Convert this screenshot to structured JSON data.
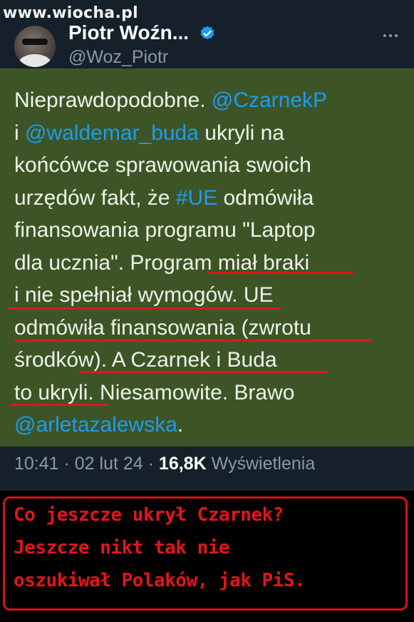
{
  "watermark": "www.wiocha.pl",
  "author": {
    "display_name": "Piotr Woźn...",
    "handle": "@Woz_Piotr"
  },
  "icons": {
    "verified": "verified-badge-icon",
    "more": "more-options-icon"
  },
  "colors": {
    "mention": "#1d9bf0",
    "tweet_highlight": "#3d5526",
    "underline": "#e0151a",
    "caption": "#e4141c"
  },
  "tweet": {
    "lines": [
      [
        {
          "text": "Nieprawdopodobne. "
        },
        {
          "text": "@CzarnekP",
          "mention": true
        }
      ],
      [
        {
          "text": "i "
        },
        {
          "text": "@waldemar_buda",
          "mention": true
        },
        {
          "text": " ukryli na"
        }
      ],
      [
        {
          "text": "końcówce sprawowania swoich"
        }
      ],
      [
        {
          "text": "urzędów fakt, że "
        },
        {
          "text": "#UE",
          "mention": true
        },
        {
          "text": " odmówiła"
        }
      ],
      [
        {
          "text": "finansowania programu \"Laptop"
        }
      ],
      [
        {
          "text": "dla ucznia\". Program miał braki"
        }
      ],
      [
        {
          "text": "i nie spełniał wymogów. UE"
        }
      ],
      [
        {
          "text": "odmówiła finansowania (zwrotu"
        }
      ],
      [
        {
          "text": "środków). A Czarnek i Buda"
        }
      ],
      [
        {
          "text": "to ukryli. Niesamowite. Brawo"
        }
      ],
      [
        {
          "text": "@arletazalewska",
          "mention": true
        },
        {
          "text": "."
        }
      ]
    ]
  },
  "meta": {
    "time": "10:41",
    "separator": " · ",
    "date": "02 lut 24",
    "views_count": "16,8K",
    "views_label": "Wyświetlenia"
  },
  "caption": {
    "lines": [
      "Co jeszcze ukrył Czarnek?",
      "Jeszcze nikt tak nie",
      "oszukiwał Polaków, jak PiS."
    ]
  }
}
